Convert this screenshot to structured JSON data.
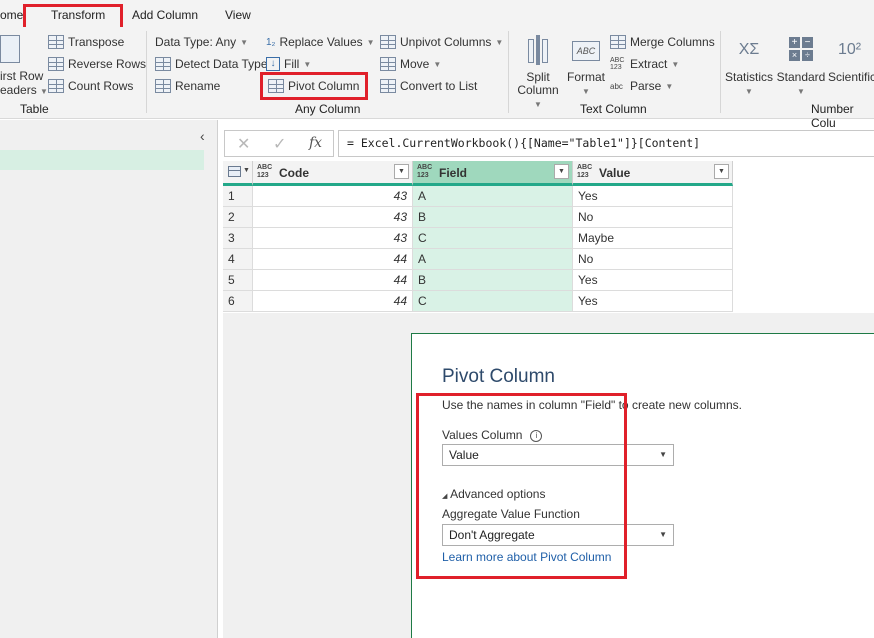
{
  "tabs": [
    {
      "label": "ome"
    },
    {
      "label": "Transform"
    },
    {
      "label": "Add Column"
    },
    {
      "label": "View"
    }
  ],
  "ribbon": {
    "table_group": {
      "label": "Table",
      "first_row_line1": "irst Row",
      "first_row_line2": "eaders",
      "transpose": "Transpose",
      "reverse_rows": "Reverse Rows",
      "count_rows": "Count Rows"
    },
    "any_column_group": {
      "label": "Any Column",
      "data_type": "Data Type: Any",
      "detect_data_type": "Detect Data Type",
      "rename": "Rename",
      "replace_values": "Replace Values",
      "fill": "Fill",
      "pivot_column": "Pivot Column",
      "unpivot_columns": "Unpivot Columns",
      "move": "Move",
      "convert_to_list": "Convert to List"
    },
    "text_column_group": {
      "label": "Text Column",
      "split_column_line1": "Split",
      "split_column_line2": "Column",
      "format": "Format",
      "merge_columns": "Merge Columns",
      "extract": "Extract",
      "parse": "Parse",
      "abc": "ABC",
      "abc123_top": "ABC",
      "abc123_bottom": "123",
      "abc_parse": "abc"
    },
    "number_column_group": {
      "label": "Number Colu",
      "statistics": "Statistics",
      "standard": "Standard",
      "scientific": "Scientific",
      "stat_symbol": "XΣ",
      "sci_symbol": "10²"
    }
  },
  "formula_bar": {
    "cancel": "✕",
    "confirm": "✓",
    "fx": "fx",
    "formula": "= Excel.CurrentWorkbook(){[Name=\"Table1\"]}[Content]"
  },
  "grid": {
    "type_top": "ABC",
    "type_bottom": "123",
    "columns": [
      "Code",
      "Field",
      "Value"
    ],
    "rows": [
      {
        "n": "1",
        "code": "43",
        "field": "A",
        "value": "Yes"
      },
      {
        "n": "2",
        "code": "43",
        "field": "B",
        "value": "No"
      },
      {
        "n": "3",
        "code": "43",
        "field": "C",
        "value": "Maybe"
      },
      {
        "n": "4",
        "code": "44",
        "field": "A",
        "value": "No"
      },
      {
        "n": "5",
        "code": "44",
        "field": "B",
        "value": "Yes"
      },
      {
        "n": "6",
        "code": "44",
        "field": "C",
        "value": "Yes"
      }
    ]
  },
  "dialog": {
    "title": "Pivot Column",
    "description": "Use the names in column \"Field\" to create new columns.",
    "values_column_label": "Values Column",
    "values_column_value": "Value",
    "advanced_options": "Advanced options",
    "aggregate_label": "Aggregate Value Function",
    "aggregate_value": "Don't Aggregate",
    "learn_more": "Learn more about Pivot Column"
  },
  "colors": {
    "highlight_red": "#e0202a",
    "selected_header": "#9fd8bd",
    "selected_cells": "#d9f2e6",
    "accent_green": "#23a889",
    "link_blue": "#1f5fa8"
  }
}
